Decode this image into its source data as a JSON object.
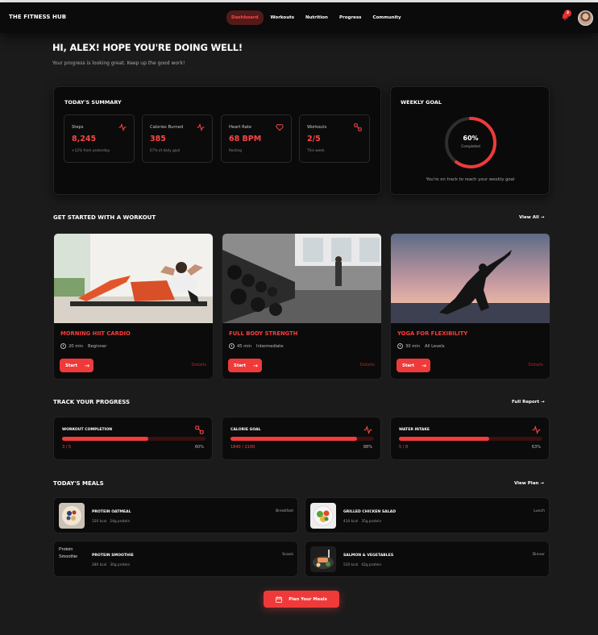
{
  "brand": "THE FITNESS HUB",
  "nav": {
    "items": [
      "Dashboard",
      "Workouts",
      "Nutrition",
      "Progress",
      "Community"
    ],
    "active": "Dashboard"
  },
  "notifications": {
    "count": "3"
  },
  "greeting": {
    "title": "HI, ALEX! HOPE YOU'RE DOING WELL!",
    "subtitle": "Your progress is looking great. Keep up the good work!"
  },
  "summary": {
    "title": "TODAY'S SUMMARY",
    "stats": [
      {
        "label": "Steps",
        "value": "8,245",
        "note": "+12% from yesterday",
        "icon": "activity-icon"
      },
      {
        "label": "Calories Burned",
        "value": "385",
        "note": "67% of daily goal",
        "icon": "activity-icon"
      },
      {
        "label": "Heart Rate",
        "value": "68 BPM",
        "note": "Resting",
        "icon": "heart-icon"
      },
      {
        "label": "Workouts",
        "value": "2/5",
        "note": "This week",
        "icon": "dumbbell-icon"
      }
    ]
  },
  "weekly_goal": {
    "title": "WEEKLY GOAL",
    "percent": "60%",
    "fraction": 0.6,
    "label": "Completed",
    "message": "You're on track to reach your weekly goal"
  },
  "workouts": {
    "title": "GET STARTED WITH A WORKOUT",
    "link": "View All",
    "items": [
      {
        "name": "MORNING HIIT CARDIO",
        "duration": "20 min",
        "level": "Beginner",
        "start": "Start",
        "details": "Details"
      },
      {
        "name": "FULL BODY STRENGTH",
        "duration": "45 min",
        "level": "Intermediate",
        "start": "Start",
        "details": "Details"
      },
      {
        "name": "YOGA FOR FLEXIBILITY",
        "duration": "30 min",
        "level": "All Levels",
        "start": "Start",
        "details": "Details"
      }
    ]
  },
  "progress": {
    "title": "TRACK YOUR PROGRESS",
    "link": "Full Report",
    "items": [
      {
        "name": "WORKOUT COMPLETION",
        "value": "3 / 5",
        "percent": "60%",
        "fraction": 0.6,
        "icon": "dumbbell-icon"
      },
      {
        "name": "CALORIE GOAL",
        "value": "1840 / 2100",
        "percent": "88%",
        "fraction": 0.88,
        "icon": "activity-icon"
      },
      {
        "name": "WATER INTAKE",
        "value": "5 / 8",
        "percent": "63%",
        "fraction": 0.63,
        "icon": "activity-icon"
      }
    ]
  },
  "meals": {
    "title": "TODAY'S MEALS",
    "link": "View Plan",
    "items": [
      {
        "name": "PROTEIN OATMEAL",
        "kcal": "320 kcal",
        "protein": "24g protein",
        "time": "Breakfast"
      },
      {
        "name": "GRILLED CHICKEN SALAD",
        "kcal": "410 kcal",
        "protein": "35g protein",
        "time": "Lunch"
      },
      {
        "name": "PROTEIN SMOOTHIE",
        "kcal": "280 kcal",
        "protein": "30g protein",
        "time": "Snack",
        "image_alt": "Protein Smoothie"
      },
      {
        "name": "SALMON & VEGETABLES",
        "kcal": "520 kcal",
        "protein": "42g protein",
        "time": "Dinner"
      }
    ],
    "cta": "Plan Your Meals"
  },
  "colors": {
    "accent": "#f03a3a",
    "background": "#1b1b1b",
    "card": "#0a0a0a"
  }
}
